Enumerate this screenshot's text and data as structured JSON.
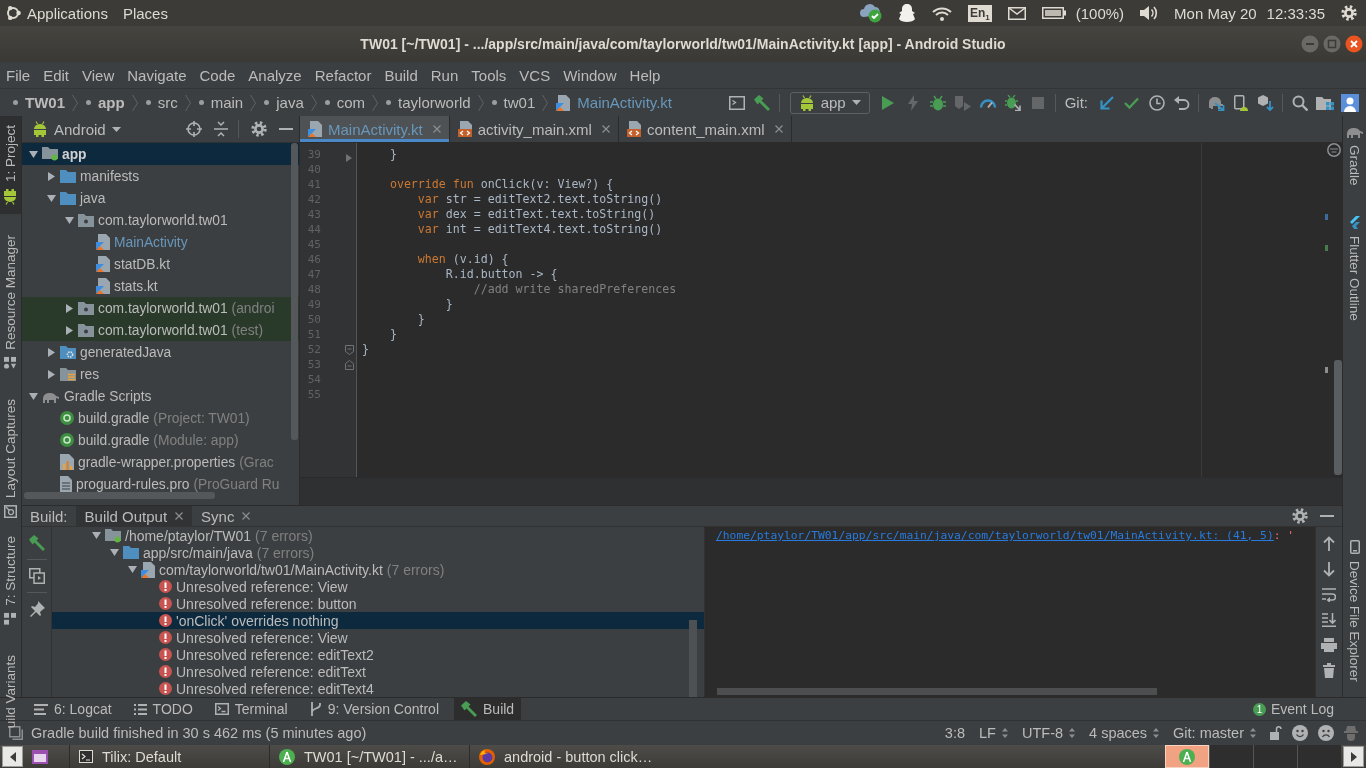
{
  "top_panel": {
    "menus": [
      "Applications",
      "Places"
    ],
    "keyboard": "En$_{1}$",
    "battery": "(100%)",
    "date": "Mon May 20",
    "time": "12:33:35"
  },
  "window": {
    "title": "TW01 [~/TW01] - .../app/src/main/java/com/taylorworld/tw01/MainActivity.kt [app] - Android Studio"
  },
  "menu": [
    "File",
    "Edit",
    "View",
    "Navigate",
    "Code",
    "Analyze",
    "Refactor",
    "Build",
    "Run",
    "Tools",
    "VCS",
    "Window",
    "Help"
  ],
  "breadcrumbs": [
    {
      "label": "TW01",
      "kind": "module",
      "modified": false
    },
    {
      "label": "app",
      "kind": "module",
      "modified": false
    },
    {
      "label": "src",
      "kind": "folder",
      "modified": false
    },
    {
      "label": "main",
      "kind": "folder",
      "modified": false
    },
    {
      "label": "java",
      "kind": "folder",
      "modified": false
    },
    {
      "label": "com",
      "kind": "folder",
      "modified": false
    },
    {
      "label": "taylorworld",
      "kind": "folder",
      "modified": false
    },
    {
      "label": "tw01",
      "kind": "folder",
      "modified": false
    },
    {
      "label": "MainActivity.kt",
      "kind": "kotlin_file",
      "modified": true
    }
  ],
  "toolbar": {
    "build": [
      {
        "kind": "layout"
      },
      {
        "kind": "make"
      }
    ],
    "run_config": "app",
    "run": [
      {
        "kind": "run",
        "disabled": false
      },
      {
        "kind": "apply_changes",
        "disabled": true
      },
      {
        "kind": "debug",
        "disabled": false
      },
      {
        "kind": "coverage",
        "disabled": true
      },
      {
        "kind": "profile",
        "disabled": false
      },
      {
        "kind": "attach_debugger",
        "disabled": false
      },
      {
        "kind": "stop",
        "disabled": true
      }
    ],
    "vcs_label": "Git:",
    "vcs": [
      {
        "kind": "update"
      },
      {
        "kind": "commit"
      },
      {
        "kind": "history"
      },
      {
        "kind": "revert"
      }
    ],
    "sdk": [
      {
        "kind": "sync"
      },
      {
        "kind": "avd"
      },
      {
        "kind": "sdk"
      }
    ],
    "end": [
      {
        "kind": "search"
      },
      {
        "kind": "structure"
      },
      {
        "kind": "account"
      }
    ]
  },
  "left_tool_windows": {
    "top": [
      {
        "label": "1: Project",
        "kind": "project",
        "selected": true
      },
      {
        "label": "Resource Manager",
        "kind": "resources",
        "selected": false
      },
      {
        "label": "Layout Captures",
        "kind": "captures",
        "selected": false
      }
    ],
    "bottom": [
      {
        "label": "7: Structure",
        "kind": "structure",
        "selected": false
      },
      {
        "label": "uild Variants",
        "kind": "variants",
        "selected": false
      }
    ]
  },
  "project": {
    "view": "Android",
    "tree": [
      {
        "label": "app",
        "kind": "module",
        "expanded": true,
        "selected": true,
        "modified": false,
        "children": [
          {
            "label": "manifests",
            "kind": "folder",
            "expanded": false,
            "selected": false,
            "modified": false
          },
          {
            "label": "java",
            "kind": "folder",
            "expanded": true,
            "selected": false,
            "modified": false,
            "children": [
              {
                "label": "com.taylorworld.tw01",
                "kind": "package",
                "expanded": true,
                "selected": false,
                "modified": false,
                "children": [
                  {
                    "label": "MainActivity",
                    "kind": "kotlin_file",
                    "selected": false,
                    "modified": true
                  },
                  {
                    "label": "statDB.kt",
                    "kind": "kotlin_file",
                    "selected": false,
                    "modified": false
                  },
                  {
                    "label": "stats.kt",
                    "kind": "kotlin_file",
                    "selected": false,
                    "modified": false
                  }
                ]
              },
              {
                "label": "com.taylorworld.tw01",
                "note": "(androi",
                "kind": "test_package",
                "expanded": false,
                "selected": false,
                "modified": false
              },
              {
                "label": "com.taylorworld.tw01",
                "note": "(test)",
                "kind": "test_package",
                "expanded": false,
                "selected": false,
                "modified": false
              }
            ]
          },
          {
            "label": "generatedJava",
            "kind": "generated_folder",
            "expanded": false,
            "selected": false,
            "modified": false
          },
          {
            "label": "res",
            "kind": "res_folder",
            "expanded": false,
            "selected": false,
            "modified": false
          }
        ]
      },
      {
        "label": "Gradle Scripts",
        "kind": "gradle_group",
        "expanded": true,
        "selected": false,
        "modified": false,
        "children": [
          {
            "label": "build.gradle",
            "note": "(Project: TW01)",
            "kind": "gradle_file",
            "selected": false,
            "modified": false
          },
          {
            "label": "build.gradle",
            "note": "(Module: app)",
            "kind": "gradle_file",
            "selected": false,
            "modified": false
          },
          {
            "label": "gradle-wrapper.properties",
            "note": "(Grac",
            "kind": "properties_file",
            "selected": false,
            "modified": false
          },
          {
            "label": "proguard-rules.pro",
            "note": "(ProGuard Ru",
            "kind": "proguard_file",
            "selected": false,
            "modified": false
          }
        ]
      }
    ]
  },
  "editor": {
    "tabs": [
      {
        "label": "MainActivity.kt",
        "kind": "kotlin",
        "selected": true,
        "modified": true
      },
      {
        "label": "activity_main.xml",
        "kind": "xml",
        "selected": false,
        "modified": false
      },
      {
        "label": "content_main.xml",
        "kind": "xml",
        "selected": false,
        "modified": false
      }
    ],
    "lines": [
      {
        "number": "39",
        "gutter": {
          "kind": "arrow"
        },
        "tokens": [
          {
            "kind": "plain",
            "text": "    }"
          }
        ]
      },
      {
        "number": "40"
      },
      {
        "number": "41",
        "tokens": [
          {
            "kind": "keyword",
            "text": "    override fun"
          },
          {
            "kind": "plain",
            "text": " onClick(v: View?) {"
          }
        ]
      },
      {
        "number": "42",
        "tokens": [
          {
            "kind": "keyword",
            "text": "        var"
          },
          {
            "kind": "plain",
            "text": " str = editText2.text.toString()"
          }
        ]
      },
      {
        "number": "43",
        "tokens": [
          {
            "kind": "keyword",
            "text": "        var"
          },
          {
            "kind": "plain",
            "text": " dex = editText.text.toString()"
          }
        ]
      },
      {
        "number": "44",
        "tokens": [
          {
            "kind": "keyword",
            "text": "        var"
          },
          {
            "kind": "plain",
            "text": " int = editText4.text.toString()"
          }
        ]
      },
      {
        "number": "45"
      },
      {
        "number": "46",
        "tokens": [
          {
            "kind": "keyword",
            "text": "        when"
          },
          {
            "kind": "plain",
            "text": " (v.id) {"
          }
        ]
      },
      {
        "number": "47",
        "tokens": [
          {
            "kind": "plain",
            "text": "            R.id.button -> {"
          }
        ]
      },
      {
        "number": "48",
        "tokens": [
          {
            "kind": "comment",
            "text": "                //add write sharedPreferences"
          }
        ]
      },
      {
        "number": "49",
        "tokens": [
          {
            "kind": "plain",
            "text": "            }"
          }
        ]
      },
      {
        "number": "50",
        "tokens": [
          {
            "kind": "plain",
            "text": "        }"
          }
        ]
      },
      {
        "number": "51",
        "tokens": [
          {
            "kind": "plain",
            "text": "    }"
          }
        ]
      },
      {
        "number": "52",
        "gutter": {
          "kind": "fold_top"
        },
        "tokens": [
          {
            "kind": "plain",
            "text": "}"
          }
        ]
      },
      {
        "number": "53",
        "gutter": {
          "kind": "fold_bottom"
        }
      },
      {
        "number": "54"
      },
      {
        "number": "55"
      }
    ]
  },
  "build": {
    "label": "Build:",
    "tabs": [
      {
        "label": "Build Output",
        "selected": true
      },
      {
        "label": "Sync",
        "selected": false
      }
    ],
    "tree": [
      {
        "label": "/home/ptaylor/TW01",
        "note": "(7 errors)",
        "kind": "module",
        "expanded": true,
        "selected": false,
        "children": [
          {
            "label": "app/src/main/java",
            "note": "(7 errors)",
            "kind": "folder",
            "expanded": true,
            "selected": false,
            "children": [
              {
                "label": "com/taylorworld/tw01/MainActivity.kt",
                "note": "(7 errors)",
                "kind": "kotlin_file",
                "expanded": true,
                "selected": false,
                "children": [
                  {
                    "label": "Unresolved reference: View",
                    "kind": "error",
                    "selected": false
                  },
                  {
                    "label": "Unresolved reference: button",
                    "kind": "error",
                    "selected": false
                  },
                  {
                    "label": "'onClick' overrides nothing",
                    "kind": "error",
                    "selected": true
                  },
                  {
                    "label": "Unresolved reference: View",
                    "kind": "error",
                    "selected": false
                  },
                  {
                    "label": "Unresolved reference: editText2",
                    "kind": "error",
                    "selected": false
                  },
                  {
                    "label": "Unresolved reference: editText",
                    "kind": "error",
                    "selected": false
                  },
                  {
                    "label": "Unresolved reference: editText4",
                    "kind": "error",
                    "selected": false
                  }
                ]
              }
            ]
          }
        ]
      }
    ],
    "console": {
      "link": "/home/ptaylor/TW01/app/src/main/java/com/taylorworld/tw01/MainActivity.kt: (41, 5)",
      "message": ": '"
    }
  },
  "right_tool_windows": {
    "top": [
      {
        "label": "Gradle",
        "kind": "gradle",
        "selected": false
      },
      {
        "label": "Flutter Outline",
        "kind": "flutter",
        "selected": false
      }
    ],
    "bottom": [
      {
        "label": "Device File Explorer",
        "kind": "device",
        "selected": false
      }
    ]
  },
  "tool_tabs": [
    {
      "label": "6: Logcat",
      "kind": "logcat",
      "selected": false
    },
    {
      "label": "TODO",
      "kind": "todo",
      "selected": false
    },
    {
      "label": "Terminal",
      "kind": "terminal",
      "selected": false
    },
    {
      "label": "9: Version Control",
      "kind": "vcs",
      "selected": false
    },
    {
      "label": "Build",
      "kind": "build",
      "selected": true
    }
  ],
  "event_log": {
    "label": "Event Log",
    "count": "1"
  },
  "status_bar": {
    "message": "Gradle build finished in 30 s 462 ms (5 minutes ago)",
    "widgets": [
      {
        "label": "3:8",
        "dropdown": false
      },
      {
        "label": "LF",
        "dropdown": true
      },
      {
        "label": "UTF-8",
        "dropdown": true
      },
      {
        "label": "4 spaces",
        "dropdown": true
      },
      {
        "label": "Git: master",
        "dropdown": true
      }
    ]
  },
  "taskbar": {
    "windows": [
      {
        "label": "Tilix: Default",
        "kind": "terminal"
      },
      {
        "label": "TW01 [~/TW01] - .../a…",
        "kind": "android_studio"
      },
      {
        "label": "android - button click…",
        "kind": "firefox"
      }
    ],
    "workspaces": [
      {
        "selected": true,
        "apps": [
          {
            "kind": "android_studio"
          }
        ]
      },
      {
        "selected": false
      },
      {
        "selected": false
      },
      {
        "selected": false
      }
    ]
  }
}
